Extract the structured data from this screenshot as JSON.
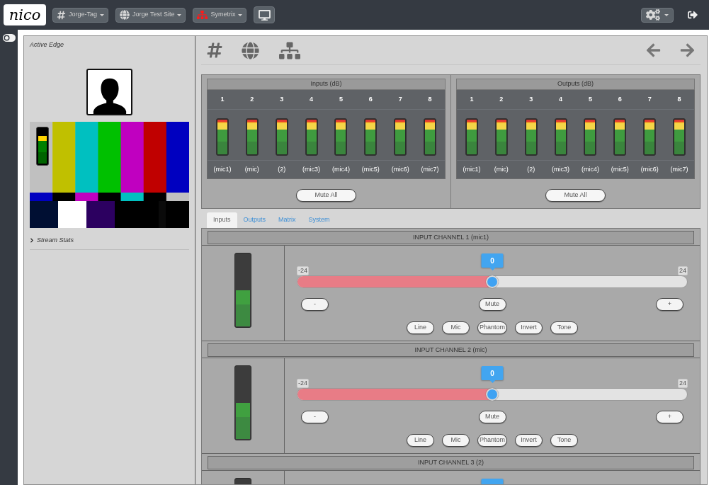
{
  "top_bar": {
    "logo": "nico",
    "menus": [
      {
        "kind": "tag",
        "label": "Jorge-Tag"
      },
      {
        "kind": "site",
        "label": "Jorge Test Site"
      },
      {
        "kind": "device",
        "label": "Symetrix"
      }
    ]
  },
  "device_panel": {
    "title": "Active Edge",
    "preview_meter": {
      "level": 0.8
    },
    "stream_stats": {
      "label": "Stream Stats",
      "expanded": false
    }
  },
  "meters": [
    {
      "title": "Inputs (dB)",
      "channels": [
        {
          "number": "1",
          "label": "(mic1)",
          "level": 1
        },
        {
          "number": "2",
          "label": "(mic)",
          "level": 1
        },
        {
          "number": "3",
          "label": "(2)",
          "level": 1
        },
        {
          "number": "4",
          "label": "(mic3)",
          "level": 1
        },
        {
          "number": "5",
          "label": "(mic4)",
          "level": 1
        },
        {
          "number": "6",
          "label": "(mic5)",
          "level": 1
        },
        {
          "number": "7",
          "label": "(mic6)",
          "level": 1
        },
        {
          "number": "8",
          "label": "(mic7)",
          "level": 1
        }
      ],
      "button": "Mute All"
    },
    {
      "title": "Outputs (dB)",
      "channels": [
        {
          "number": "1",
          "label": "(mic1)",
          "level": 1
        },
        {
          "number": "2",
          "label": "(mic)",
          "level": 1
        },
        {
          "number": "3",
          "label": "(2)",
          "level": 1
        },
        {
          "number": "4",
          "label": "(mic3)",
          "level": 1
        },
        {
          "number": "5",
          "label": "(mic4)",
          "level": 1
        },
        {
          "number": "6",
          "label": "(mic5)",
          "level": 1
        },
        {
          "number": "7",
          "label": "(mic6)",
          "level": 1
        },
        {
          "number": "8",
          "label": "(mic7)",
          "level": 1
        }
      ],
      "button": "Mute All"
    }
  ],
  "tabs": [
    {
      "label": "Inputs",
      "selected": true
    },
    {
      "label": "Outputs",
      "selected": false
    },
    {
      "label": "Matrix",
      "selected": false
    },
    {
      "label": "System",
      "selected": false
    }
  ],
  "input_channels": [
    {
      "title": "INPUT CHANNEL 1 (mic1)",
      "meter": {
        "level": 0.5
      },
      "gain": {
        "level": 0.5,
        "value": "0",
        "min": "-24",
        "max": "24"
      },
      "buttons": [
        "-",
        "Mute",
        "+"
      ],
      "modes": [
        "Line",
        "Mic",
        "Phantom",
        "Invert",
        "Tone"
      ]
    },
    {
      "title": "INPUT CHANNEL 2 (mic)",
      "meter": {
        "level": 0.5
      },
      "gain": {
        "level": 0.5,
        "value": "0",
        "min": "-24",
        "max": "24"
      },
      "buttons": [
        "-",
        "Mute",
        "+"
      ],
      "modes": [
        "Line",
        "Mic",
        "Phantom",
        "Invert",
        "Tone"
      ]
    },
    {
      "title": "INPUT CHANNEL 3 (2)",
      "gain": {
        "level": 0.5
      }
    }
  ]
}
